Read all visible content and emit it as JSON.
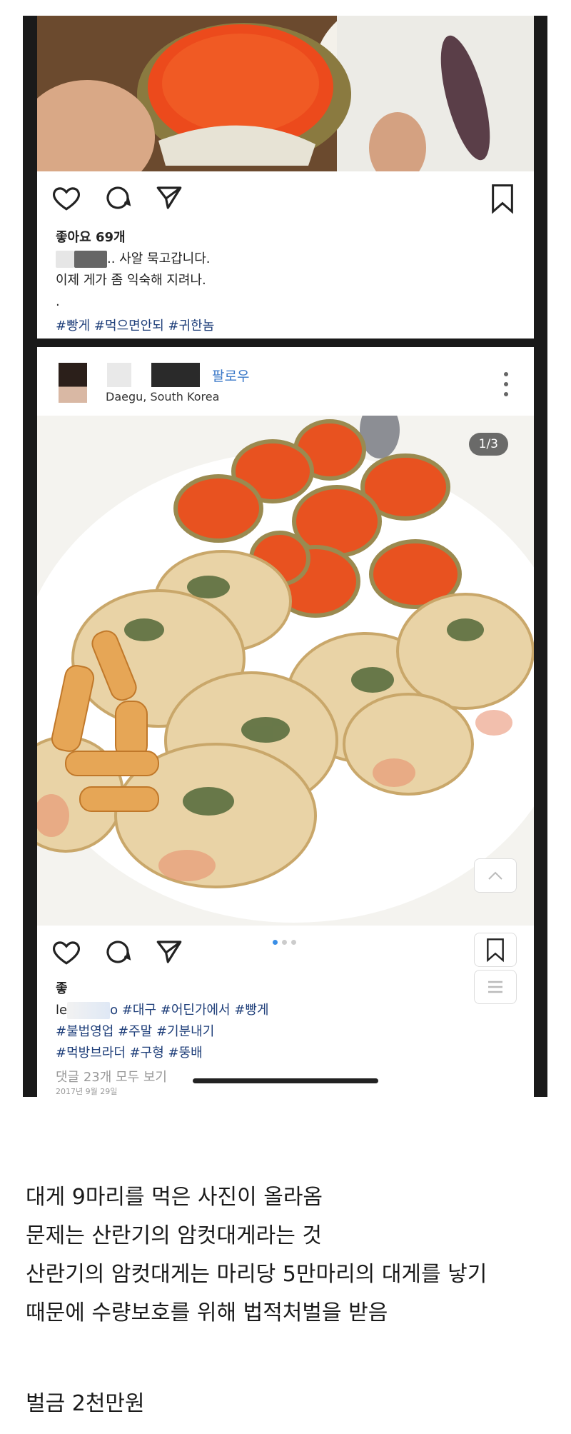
{
  "post1": {
    "likes": "좋아요 69개",
    "caption_line1": ".. 사알 묵고갑니다.",
    "caption_line2": "이제 게가 좀 익숙해 지려나.",
    "caption_line3": ".",
    "hashtags": "#빵게 #먹으면안되 #귀한놈"
  },
  "post2": {
    "follow": "팔로우",
    "location": "Daegu, South Korea",
    "counter": "1/3",
    "likes_partial": "좋",
    "caption_prefix": "le",
    "caption_rest": "o #대구 #어딘가에서 #빵게",
    "hashtags_line2": "#불법영업 #주말 #기분내기",
    "hashtags_line3": "#먹방브라더 #구형 #뚱배",
    "view_comments": "댓글 23개 모두 보기",
    "date_partial": "2017년 9월 29일"
  },
  "article": {
    "line1": "대게 9마리를 먹은 사진이 올라옴",
    "line2": "문제는 산란기의 암컷대게라는 것",
    "line3": "산란기의 암컷대게는 마리당 5만마리의 대게를 낳기",
    "line4": "때문에 수량보호를 위해 법적처벌을 받음",
    "fine": "벌금 2천만원"
  },
  "icons": [
    "heart-icon",
    "comment-icon",
    "share-icon",
    "bookmark-icon",
    "more-icon",
    "list-icon",
    "chevron-up-icon"
  ]
}
